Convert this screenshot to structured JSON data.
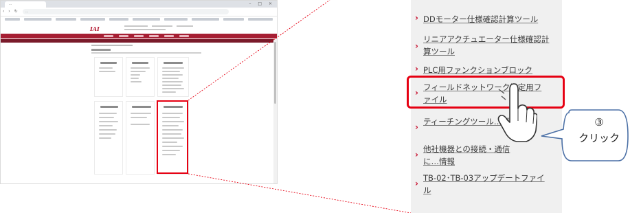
{
  "browser": {
    "tab_title": "…",
    "url": "…",
    "logo": "IAI"
  },
  "sidebar": {
    "items": [
      {
        "label": "DDモーター仕様確認計算ツール"
      },
      {
        "label": "リニアアクチュエーター仕様確認計算ツール"
      },
      {
        "label": "PLC用ファンクションブロック"
      },
      {
        "label": "フィールドネットワーク設定用ファイル"
      },
      {
        "label": "ティーチングツール…歴"
      },
      {
        "label": "他社機器との接続・通信に…情報"
      },
      {
        "label": "TB-02･TB-03アップデートファイル"
      }
    ]
  },
  "callout": {
    "step": "③",
    "action": "クリック"
  },
  "colors": {
    "highlight": "#e60012",
    "site_nav": "#a61e33",
    "panel_bg": "#f0f0f0",
    "chevron": "#c8102e"
  },
  "icons": {
    "pointer": "hand-pointer-icon",
    "chevron": "chevron-right-icon"
  }
}
